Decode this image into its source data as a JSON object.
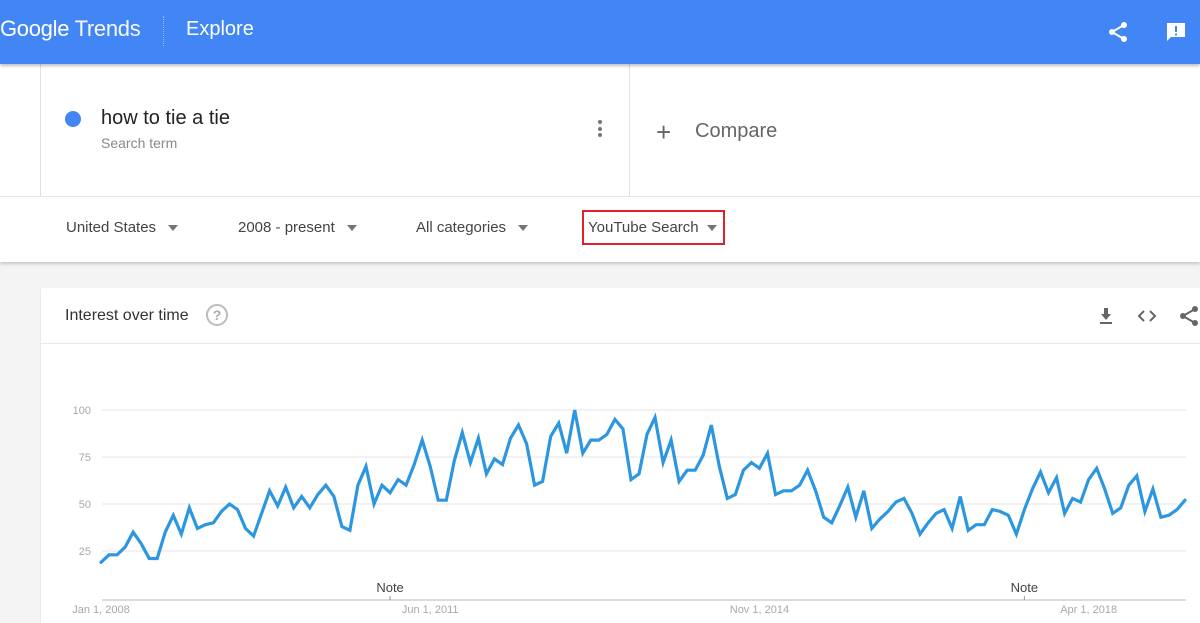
{
  "header": {
    "logo_google": "Google",
    "logo_trends": "Trends",
    "page_title": "Explore",
    "share_icon": "share-icon",
    "feedback_icon": "feedback-icon",
    "brand_color": "#4285f4"
  },
  "search_term": {
    "term": "how to tie a tie",
    "subtitle": "Search term",
    "dot_color": "#4285f4",
    "menu_icon": "more-vert-icon"
  },
  "compare": {
    "icon": "plus-icon",
    "label": "Compare"
  },
  "filters": [
    {
      "label": "United States",
      "highlighted": false
    },
    {
      "label": "2008 - present",
      "highlighted": false
    },
    {
      "label": "All categories",
      "highlighted": false
    },
    {
      "label": "YouTube Search",
      "highlighted": true
    }
  ],
  "highlight_color": "#e0202a",
  "card": {
    "title": "Interest over time",
    "help_icon": "help-icon",
    "help_glyph": "?",
    "actions": [
      "download-icon",
      "embed-icon",
      "share-icon"
    ]
  },
  "chart_data": {
    "type": "line",
    "title": "Interest over time",
    "xlabel": "",
    "ylabel": "",
    "ylim": [
      0,
      100
    ],
    "yticks": [
      25,
      50,
      75,
      100
    ],
    "grid": true,
    "legend": "none",
    "series_color": "#2d96e0",
    "x_start": "Jan 2008",
    "x_interval": "monthly",
    "x_tick_labels": [
      {
        "label": "Jan 1, 2008",
        "index": 0
      },
      {
        "label": "Jun 1, 2011",
        "index": 41
      },
      {
        "label": "Nov 1, 2014",
        "index": 82
      },
      {
        "label": "Apr 1, 2018",
        "index": 123
      }
    ],
    "annotations": [
      {
        "label": "Note",
        "index": 36
      },
      {
        "label": "Note",
        "index": 115
      }
    ],
    "series": [
      {
        "name": "how to tie a tie",
        "values": [
          19,
          23,
          23,
          27,
          35,
          29,
          21,
          21,
          35,
          44,
          34,
          48,
          37,
          39,
          40,
          46,
          50,
          47,
          37,
          33,
          45,
          57,
          49,
          59,
          48,
          54,
          48,
          55,
          60,
          54,
          38,
          36,
          60,
          70,
          50,
          60,
          56,
          63,
          60,
          71,
          84,
          70,
          52,
          52,
          73,
          88,
          72,
          85,
          66,
          74,
          71,
          85,
          92,
          82,
          60,
          62,
          86,
          93,
          77,
          100,
          77,
          84,
          84,
          87,
          95,
          90,
          63,
          66,
          87,
          96,
          72,
          84,
          62,
          68,
          68,
          76,
          92,
          70,
          53,
          55,
          68,
          72,
          69,
          77,
          55,
          57,
          57,
          60,
          68,
          57,
          43,
          40,
          49,
          59,
          43,
          57,
          37,
          42,
          46,
          51,
          53,
          45,
          34,
          40,
          45,
          47,
          37,
          54,
          36,
          39,
          39,
          47,
          46,
          44,
          34,
          47,
          58,
          67,
          56,
          64,
          45,
          53,
          51,
          63,
          69,
          58,
          45,
          48,
          60,
          65,
          46,
          58,
          43,
          44,
          47,
          52
        ]
      }
    ]
  }
}
